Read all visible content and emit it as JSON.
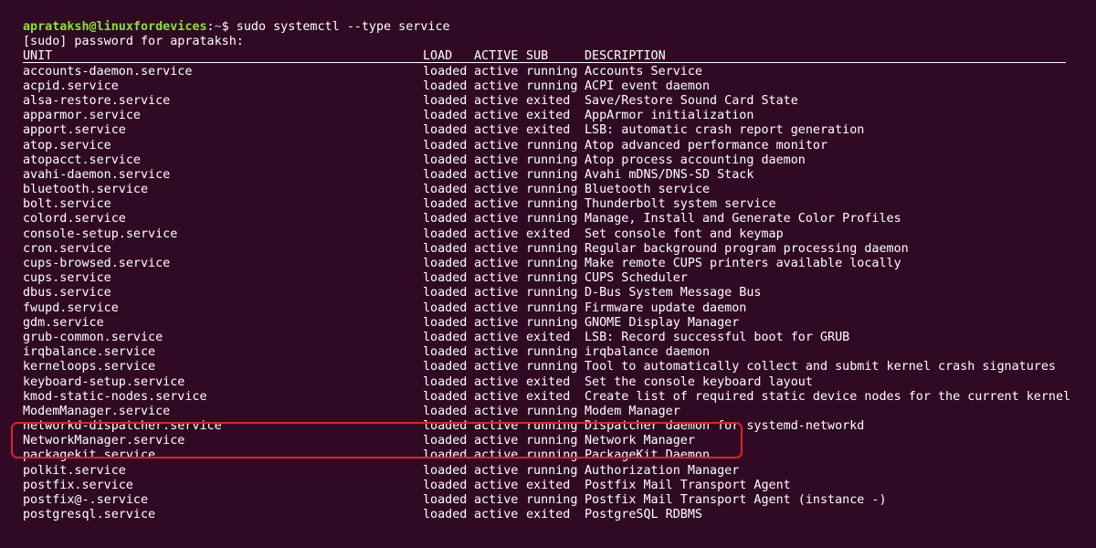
{
  "prompt": {
    "user_host": "apratakshlinuxfordevices",
    "user": "aprataksh@linuxfordevices",
    "separator": ":",
    "path": "~",
    "symbol": "$",
    "command": " sudo systemctl --type service"
  },
  "sudo_prompt": "[sudo] password for aprataksh:",
  "headers": {
    "unit": "UNIT",
    "load": "LOAD",
    "active": "ACTIVE",
    "sub": "SUB",
    "description": "DESCRIPTION"
  },
  "rows": [
    {
      "unit": "accounts-daemon.service",
      "load": "loaded",
      "active": "active",
      "sub": "running",
      "description": "Accounts Service"
    },
    {
      "unit": "acpid.service",
      "load": "loaded",
      "active": "active",
      "sub": "running",
      "description": "ACPI event daemon"
    },
    {
      "unit": "alsa-restore.service",
      "load": "loaded",
      "active": "active",
      "sub": "exited",
      "description": "Save/Restore Sound Card State"
    },
    {
      "unit": "apparmor.service",
      "load": "loaded",
      "active": "active",
      "sub": "exited",
      "description": "AppArmor initialization"
    },
    {
      "unit": "apport.service",
      "load": "loaded",
      "active": "active",
      "sub": "exited",
      "description": "LSB: automatic crash report generation"
    },
    {
      "unit": "atop.service",
      "load": "loaded",
      "active": "active",
      "sub": "running",
      "description": "Atop advanced performance monitor"
    },
    {
      "unit": "atopacct.service",
      "load": "loaded",
      "active": "active",
      "sub": "running",
      "description": "Atop process accounting daemon"
    },
    {
      "unit": "avahi-daemon.service",
      "load": "loaded",
      "active": "active",
      "sub": "running",
      "description": "Avahi mDNS/DNS-SD Stack"
    },
    {
      "unit": "bluetooth.service",
      "load": "loaded",
      "active": "active",
      "sub": "running",
      "description": "Bluetooth service"
    },
    {
      "unit": "bolt.service",
      "load": "loaded",
      "active": "active",
      "sub": "running",
      "description": "Thunderbolt system service"
    },
    {
      "unit": "colord.service",
      "load": "loaded",
      "active": "active",
      "sub": "running",
      "description": "Manage, Install and Generate Color Profiles"
    },
    {
      "unit": "console-setup.service",
      "load": "loaded",
      "active": "active",
      "sub": "exited",
      "description": "Set console font and keymap"
    },
    {
      "unit": "cron.service",
      "load": "loaded",
      "active": "active",
      "sub": "running",
      "description": "Regular background program processing daemon"
    },
    {
      "unit": "cups-browsed.service",
      "load": "loaded",
      "active": "active",
      "sub": "running",
      "description": "Make remote CUPS printers available locally"
    },
    {
      "unit": "cups.service",
      "load": "loaded",
      "active": "active",
      "sub": "running",
      "description": "CUPS Scheduler"
    },
    {
      "unit": "dbus.service",
      "load": "loaded",
      "active": "active",
      "sub": "running",
      "description": "D-Bus System Message Bus"
    },
    {
      "unit": "fwupd.service",
      "load": "loaded",
      "active": "active",
      "sub": "running",
      "description": "Firmware update daemon"
    },
    {
      "unit": "gdm.service",
      "load": "loaded",
      "active": "active",
      "sub": "running",
      "description": "GNOME Display Manager"
    },
    {
      "unit": "grub-common.service",
      "load": "loaded",
      "active": "active",
      "sub": "exited",
      "description": "LSB: Record successful boot for GRUB"
    },
    {
      "unit": "irqbalance.service",
      "load": "loaded",
      "active": "active",
      "sub": "running",
      "description": "irqbalance daemon"
    },
    {
      "unit": "kerneloops.service",
      "load": "loaded",
      "active": "active",
      "sub": "running",
      "description": "Tool to automatically collect and submit kernel crash signatures"
    },
    {
      "unit": "keyboard-setup.service",
      "load": "loaded",
      "active": "active",
      "sub": "exited",
      "description": "Set the console keyboard layout"
    },
    {
      "unit": "kmod-static-nodes.service",
      "load": "loaded",
      "active": "active",
      "sub": "exited",
      "description": "Create list of required static device nodes for the current kernel"
    },
    {
      "unit": "ModemManager.service",
      "load": "loaded",
      "active": "active",
      "sub": "running",
      "description": "Modem Manager"
    },
    {
      "unit": "networkd-dispatcher.service",
      "load": "loaded",
      "active": "active",
      "sub": "running",
      "description": "Dispatcher daemon for systemd-networkd"
    },
    {
      "unit": "NetworkManager.service",
      "load": "loaded",
      "active": "active",
      "sub": "running",
      "description": "Network Manager"
    },
    {
      "unit": "packagekit.service",
      "load": "loaded",
      "active": "active",
      "sub": "running",
      "description": "PackageKit Daemon"
    },
    {
      "unit": "polkit.service",
      "load": "loaded",
      "active": "active",
      "sub": "running",
      "description": "Authorization Manager"
    },
    {
      "unit": "postfix.service",
      "load": "loaded",
      "active": "active",
      "sub": "exited",
      "description": "Postfix Mail Transport Agent"
    },
    {
      "unit": "postfix@-.service",
      "load": "loaded",
      "active": "active",
      "sub": "running",
      "description": "Postfix Mail Transport Agent (instance -)"
    },
    {
      "unit": "postgresql.service",
      "load": "loaded",
      "active": "active",
      "sub": "exited",
      "description": "PostgreSQL RDBMS"
    }
  ],
  "colors": {
    "background": "#300a24",
    "text": "#ffffff",
    "prompt_user": "#8ae234",
    "prompt_path": "#729fcf",
    "highlight": "#e0202a"
  }
}
